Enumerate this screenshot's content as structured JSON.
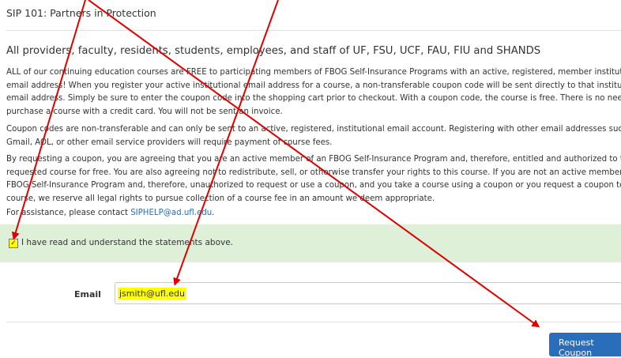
{
  "page": {
    "title": "SIP 101: Partners in Protection",
    "heading": "All providers, faculty, residents, students, employees, and staff of UF, FSU, UCF, FAU, FIU and SHANDS"
  },
  "paragraphs": {
    "p1": [
      "ALL of our continuing education courses are FREE to participating members of FBOG Self-Insurance Programs with an active, registered, member institution",
      "email address! When you register your active institutional email address for a course, a non-transferable coupon code will be sent directly to that institutional",
      "email address. Simply be sure to enter the coupon code into the shopping cart prior to checkout. With a coupon code, the course is free. There is no need to",
      "purchase a course with a credit card. You will not be sent an invoice."
    ],
    "p2": [
      "Coupon codes are non-transferable and can only be sent to an active, registered, institutional email account. Registering with other email addresses such as",
      "Gmail, AOL, or other email service providers will require payment of course fees."
    ],
    "p3": [
      "By requesting a coupon, you are agreeing that you are an active member of an FBOG Self-Insurance Program and, therefore, entitled and authorized to take th",
      "requested course for free. You are also agreeing not to redistribute, sell, or otherwise transfer your rights to this course. If you are not an active member of ar",
      "FBOG Self-Insurance Program and, therefore, unauthorized to request or use a coupon, and you take a course using a coupon or you request a coupon to take a",
      "course, we reserve all legal rights to pursue collection of a course fee in an amount we deem appropriate."
    ],
    "assist_prefix": "For assistance, please contact ",
    "assist_email": "SIPHELP@ad.ufl.edu",
    "assist_suffix": "."
  },
  "ack": {
    "checked": true,
    "check_glyph": "✓",
    "label": "I have read and understand the statements above."
  },
  "form": {
    "email_label": "Email",
    "email_value": "jsmith@ufl.edu"
  },
  "actions": {
    "request_coupon": "Request Coupon"
  },
  "annotations": {
    "arrow_color": "#e00000",
    "highlight_color": "#ffff00"
  }
}
